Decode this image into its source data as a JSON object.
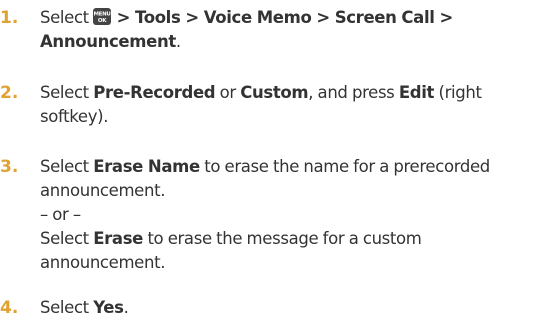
{
  "steps": [
    {
      "number": "1.",
      "select": "Select",
      "path": "> Tools > Voice Memo > Screen Call >",
      "path_end": "Announcement",
      "period": ".",
      "menu_key_top": "MENU",
      "menu_key_bottom": "OK"
    },
    {
      "number": "2.",
      "select": "Select",
      "option1": "Pre-Recorded",
      "or": "or",
      "option2": "Custom",
      "and_press": ", and press",
      "edit": "Edit",
      "paren1": "(right",
      "paren2": "softkey)."
    },
    {
      "number": "3.",
      "select": "Select",
      "erase_name": "Erase Name",
      "text1": "to erase the name for a prerecorded",
      "text2": "announcement.",
      "or_line": "– or –",
      "select2": "Select",
      "erase": "Erase",
      "text3": "to erase the message for a custom",
      "text4": "announcement."
    },
    {
      "number": "4.",
      "select": "Select",
      "yes": "Yes",
      "period": "."
    }
  ],
  "colors": {
    "step_number": "#e0a233",
    "text": "#333333",
    "menu_key": "#444444"
  }
}
